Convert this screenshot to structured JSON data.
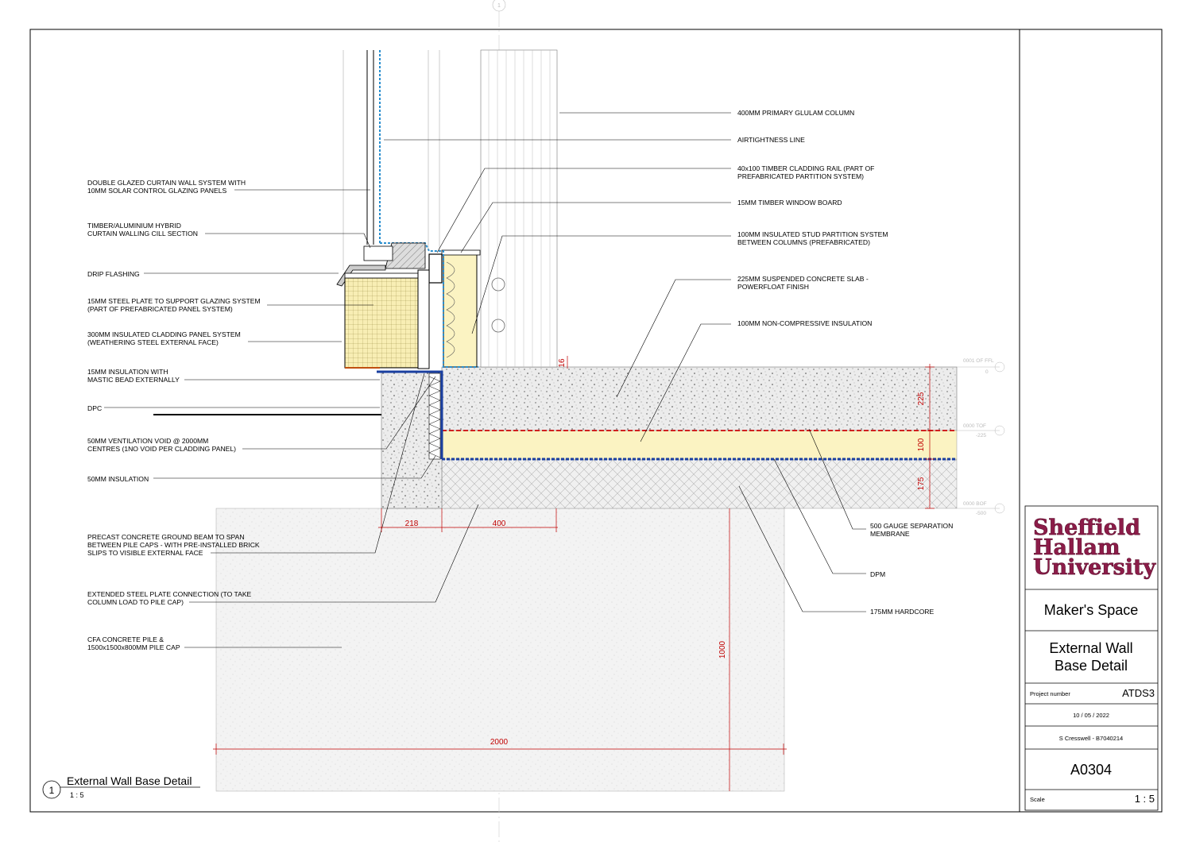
{
  "labels_left": [
    {
      "line1": "DOUBLE GLAZED CURTAIN WALL SYSTEM WITH",
      "line2": "10MM SOLAR CONTROL GLAZING PANELS"
    },
    {
      "line1": "TIMBER/ALUMINIUM HYBRID",
      "line2": "CURTAIN WALLING CILL SECTION"
    },
    {
      "line1": "DRIP FLASHING",
      "line2": ""
    },
    {
      "line1": "15MM STEEL PLATE TO SUPPORT GLAZING SYSTEM",
      "line2": "(PART OF PREFABRICATED PANEL SYSTEM)"
    },
    {
      "line1": "300MM INSULATED CLADDING PANEL SYSTEM",
      "line2": "(WEATHERING STEEL EXTERNAL FACE)"
    },
    {
      "line1": "15MM INSULATION WITH",
      "line2": "MASTIC BEAD EXTERNALLY"
    },
    {
      "line1": "DPC",
      "line2": ""
    },
    {
      "line1": "50MM VENTILATION VOID @ 2000MM",
      "line2": "CENTRES (1NO VOID PER CLADDING PANEL)"
    },
    {
      "line1": "50MM INSULATION",
      "line2": ""
    },
    {
      "line1": "PRECAST CONCRETE GROUND BEAM TO SPAN",
      "line2": "BETWEEN PILE CAPS - WITH PRE-INSTALLED BRICK",
      "line3": "SLIPS TO VISIBLE EXTERNAL FACE"
    },
    {
      "line1": "EXTENDED STEEL  PLATE CONNECTION (TO TAKE",
      "line2": "COLUMN LOAD TO PILE CAP)"
    },
    {
      "line1": "CFA CONCRETE PILE &",
      "line2": "1500x1500x800MM PILE CAP"
    }
  ],
  "labels_right": [
    {
      "line1": "400MM PRIMARY GLULAM COLUMN",
      "line2": ""
    },
    {
      "line1": "AIRTIGHTNESS LINE",
      "line2": ""
    },
    {
      "line1": "40x100 TIMBER CLADDING RAIL (PART OF",
      "line2": "PREFABRICATED PARTITION SYSTEM)"
    },
    {
      "line1": "15MM TIMBER WINDOW BOARD",
      "line2": ""
    },
    {
      "line1": "100MM INSULATED STUD PARTITION SYSTEM",
      "line2": "BETWEEN COLUMNS (PREFABRICATED)"
    },
    {
      "line1": "225MM SUSPENDED CONCRETE SLAB -",
      "line2": "POWERFLOAT FINISH"
    },
    {
      "line1": "100MM NON-COMPRESSIVE INSULATION",
      "line2": ""
    },
    {
      "line1": "500 GAUGE SEPARATION",
      "line2": "MEMBRANE"
    },
    {
      "line1": "DPM",
      "line2": ""
    },
    {
      "line1": "175MM HARDCORE",
      "line2": ""
    }
  ],
  "dimensions": {
    "d218": "218",
    "d400": "400",
    "d16": "16",
    "d225": "225",
    "d100": "100",
    "d175": "175",
    "d1000": "1000",
    "d2000": "2000"
  },
  "levels": {
    "ffl_name": "0001 OF FFL",
    "ffl_value": "0",
    "tof_name": "0000 TOF",
    "tof_value": "-225",
    "bof_name": "0000 BOF",
    "bof_value": "-500"
  },
  "view": {
    "number": "1",
    "title": "External Wall Base Detail",
    "scale": "1 : 5"
  },
  "grid_marker": "1",
  "title_block": {
    "logo_line1": "Sheffield",
    "logo_line2": "Hallam",
    "logo_line3": "University",
    "project_name": "Maker's Space",
    "sheet_title_line1": "External Wall",
    "sheet_title_line2": "Base Detail",
    "project_number_label": "Project number",
    "project_number": "ATDS3",
    "date": "10 / 05 / 2022",
    "author": "S Cresswell - B7040214",
    "sheet_number": "A0304",
    "scale_label": "Scale",
    "scale": "1 : 5"
  },
  "colors": {
    "annotation_red": "#c00000",
    "airtightness_blue": "#2a8fcf",
    "dpm_blue": "#1a3fa0",
    "insulation_yellow": "#fbf3c2",
    "logo_maroon": "#8c1c49"
  }
}
